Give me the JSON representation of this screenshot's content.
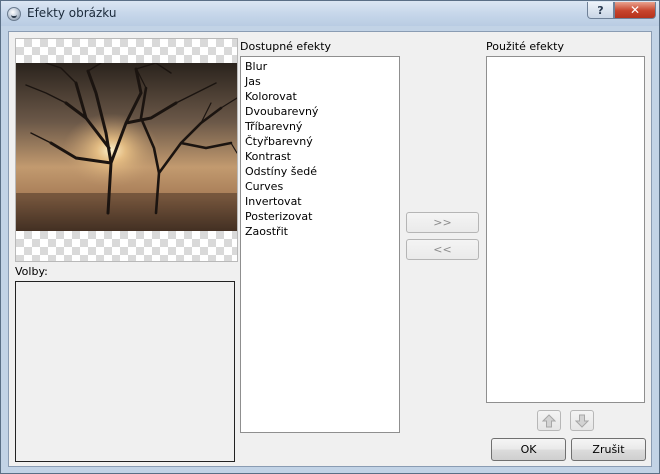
{
  "window": {
    "title": "Efekty obrázku",
    "help_label": "?",
    "close_label": "✕"
  },
  "options_label": "Volby:",
  "available": {
    "label": "Dostupné efekty",
    "items": [
      "Blur",
      "Jas",
      "Kolorovat",
      "Dvoubarevný",
      "Tříbarevný",
      "Čtyřbarevný",
      "Kontrast",
      "Odstíny šedé",
      "Curves",
      "Invertovat",
      "Posterizovat",
      "Zaostřit"
    ]
  },
  "used": {
    "label": "Použité efekty",
    "items": []
  },
  "buttons": {
    "add": ">>",
    "remove": "<<",
    "ok": "OK",
    "cancel": "Zrušit"
  },
  "icons": {
    "up": "arrow-up-icon",
    "down": "arrow-down-icon",
    "app": "app-icon"
  },
  "colors": {
    "titlebar": "#c7d7ea",
    "close": "#c7432b",
    "dialog_bg": "#f0f0f0",
    "disabled_text": "#8d8d8d"
  }
}
